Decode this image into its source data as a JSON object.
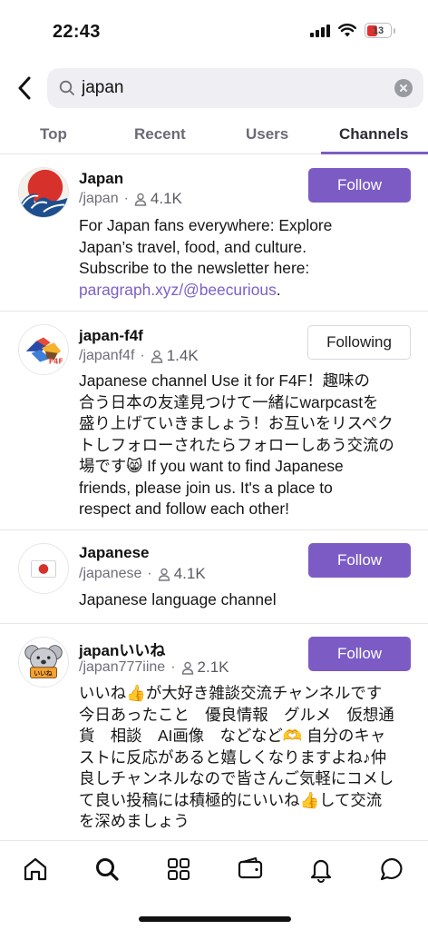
{
  "status_bar": {
    "time": "22:43",
    "battery": "13"
  },
  "search": {
    "query": "japan",
    "placeholder": "Search"
  },
  "tabs": [
    {
      "label": "Top",
      "active": false
    },
    {
      "label": "Recent",
      "active": false
    },
    {
      "label": "Users",
      "active": false
    },
    {
      "label": "Channels",
      "active": true
    }
  ],
  "channels": [
    {
      "name": "Japan",
      "handle": "/japan",
      "followers": "4.1K",
      "button": "Follow",
      "description_lines": [
        "For Japan fans everywhere: Explore",
        "Japan’s travel, food, and culture.",
        "Subscribe to the newsletter here:"
      ],
      "link": "paragraph.xyz/@beecurious",
      "link_suffix": "."
    },
    {
      "name": "japan-f4f",
      "handle": "/japanf4f",
      "followers": "1.4K",
      "button": "Following",
      "description_lines": [
        "Japanese channel  Use it for F4F！趣味の",
        "合う日本の友達見つけて一緒にwarpcastを",
        "盛り上げていきましょう！お互いをリスペク",
        "トしフォローされたらフォローしあう交流の",
        "場です😸 If you want to find Japanese",
        "friends, please join us. It's a place to",
        "respect and follow each other!"
      ]
    },
    {
      "name": "Japanese",
      "handle": "/japanese",
      "followers": "4.1K",
      "button": "Follow",
      "description_lines": [
        "Japanese language channel"
      ]
    },
    {
      "name": "japanいいね",
      "handle": "/japan777iine",
      "followers": "2.1K",
      "button": "Follow",
      "description_lines": [
        "いいね👍が大好き雑談交流チャンネルです",
        "今日あったこと　優良情報　グルメ　仮想通",
        "貨　相談　AI画像　などなど🫶 自分のキャ",
        "ストに反応があると嬉しくなりますよね♪仲",
        "良しチャンネルなので皆さんご気軽にコメし",
        "て良い投稿には積極的にいいね👍して交流",
        "を深めましょう"
      ]
    }
  ],
  "colors": {
    "accent": "#7c5cc4",
    "link": "#7d5fc6",
    "muted": "#6e6e78"
  },
  "bottom_nav": [
    "home-icon",
    "search-icon",
    "apps-grid-icon",
    "wallet-icon",
    "bell-icon",
    "chat-icon"
  ]
}
